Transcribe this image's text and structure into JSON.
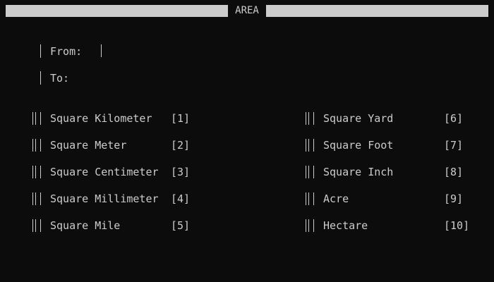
{
  "title": "AREA",
  "fields": {
    "from_label": "From:",
    "from_value": "",
    "to_label": "To:",
    "to_value": ""
  },
  "units_left": [
    {
      "label": "Square Kilometer",
      "key": "[1]"
    },
    {
      "label": "Square Meter",
      "key": "[2]"
    },
    {
      "label": "Square Centimeter",
      "key": "[3]"
    },
    {
      "label": "Square Millimeter",
      "key": "[4]"
    },
    {
      "label": "Square Mile",
      "key": "[5]"
    }
  ],
  "units_right": [
    {
      "label": "Square Yard",
      "key": "[6]"
    },
    {
      "label": "Square Foot",
      "key": "[7]"
    },
    {
      "label": "Square Inch",
      "key": "[8]"
    },
    {
      "label": "Acre",
      "key": "[9]"
    },
    {
      "label": "Hectare",
      "key": "[10]"
    }
  ],
  "colors": {
    "background": "#0c0c0c",
    "foreground": "#cccccc"
  }
}
